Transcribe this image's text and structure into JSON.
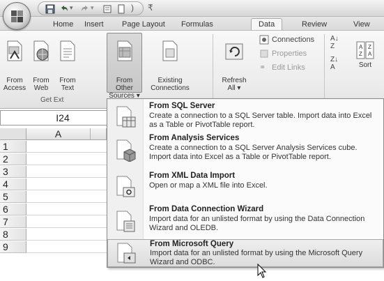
{
  "ribbon_tabs": [
    {
      "label": "Home"
    },
    {
      "label": "Insert"
    },
    {
      "label": "Page Layout"
    },
    {
      "label": "Formulas"
    },
    {
      "label": "Data"
    },
    {
      "label": "Review"
    },
    {
      "label": "View"
    }
  ],
  "active_tab": "Data",
  "get_external_data": {
    "group_label": "Get Ext",
    "buttons": [
      {
        "label": "From Access",
        "icon": "access-db-icon"
      },
      {
        "label": "From Web",
        "icon": "web-globe-icon"
      },
      {
        "label": "From Text",
        "icon": "text-file-icon"
      },
      {
        "label": "From Other Sources",
        "icon": "other-sources-icon",
        "pressed": true
      },
      {
        "label": "Existing Connections",
        "icon": "connections-icon"
      }
    ]
  },
  "connections_group": {
    "refresh_label": "Refresh All",
    "connections_label": "Connections",
    "properties_label": "Properties",
    "edit_links_label": "Edit Links"
  },
  "sort_group": {
    "sort_label": "Sort"
  },
  "name_box": "I24",
  "columns": [
    "A"
  ],
  "rows": [
    "1",
    "2",
    "3",
    "4",
    "5",
    "6",
    "7",
    "8",
    "9"
  ],
  "other_sources_menu": [
    {
      "title": "From SQL Server",
      "description": "Create a connection to a SQL Server table. Import data into Excel as a Table or PivotTable report."
    },
    {
      "title": "From Analysis Services",
      "description": "Create a connection to a SQL Server Analysis Services cube. Import data into Excel as a Table or PivotTable report."
    },
    {
      "title": "From XML Data Import",
      "description": "Open or map a XML file into Excel."
    },
    {
      "title": "From Data Connection Wizard",
      "description": "Import data for an unlisted format by using the Data Connection Wizard and OLEDB."
    },
    {
      "title": "From Microsoft Query",
      "description": "Import data for an unlisted format by using the Microsoft Query Wizard and ODBC.",
      "hover": true
    }
  ]
}
